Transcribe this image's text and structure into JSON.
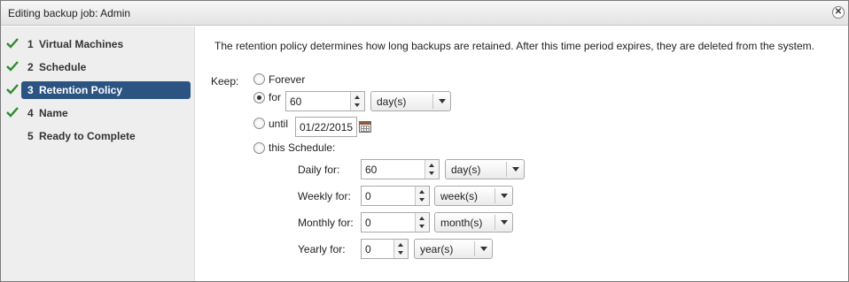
{
  "window": {
    "title": "Editing backup job: Admin"
  },
  "steps": [
    {
      "num": "1",
      "label": "Virtual Machines",
      "completed": true,
      "active": false
    },
    {
      "num": "2",
      "label": "Schedule",
      "completed": true,
      "active": false
    },
    {
      "num": "3",
      "label": "Retention Policy",
      "completed": true,
      "active": true
    },
    {
      "num": "4",
      "label": "Name",
      "completed": true,
      "active": false
    },
    {
      "num": "5",
      "label": "Ready to Complete",
      "completed": false,
      "active": false
    }
  ],
  "content": {
    "description": "The retention policy determines how long backups are retained.  After this time period expires, they are deleted from the system.",
    "keep_label": "Keep:",
    "options": {
      "forever": {
        "label": "Forever",
        "selected": false
      },
      "for": {
        "label": "for",
        "selected": true,
        "value": "60",
        "unit": "day(s)"
      },
      "until": {
        "label": "until",
        "selected": false,
        "date": "01/22/2015"
      },
      "schedule": {
        "label": "this Schedule:",
        "selected": false
      }
    },
    "schedule": {
      "daily": {
        "label": "Daily for:",
        "value": "60",
        "unit": "day(s)"
      },
      "weekly": {
        "label": "Weekly for:",
        "value": "0",
        "unit": "week(s)"
      },
      "monthly": {
        "label": "Monthly for:",
        "value": "0",
        "unit": "month(s)"
      },
      "yearly": {
        "label": "Yearly for:",
        "value": "0",
        "unit": "year(s)"
      }
    }
  },
  "colors": {
    "active_step_bg": "#2c5483",
    "check": "#2e8b2e",
    "sidebar_bg": "#eeeeee"
  }
}
